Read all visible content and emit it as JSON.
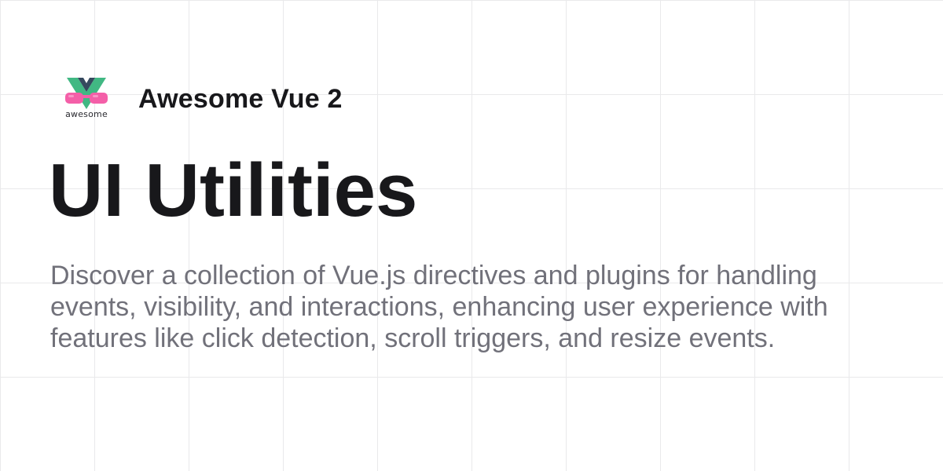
{
  "brand": {
    "logo_icon": "awesome-vue-logo-icon",
    "logo_text": "awesome",
    "name": "Awesome Vue 2"
  },
  "page": {
    "title": "UI Utilities",
    "description": "Discover a collection of Vue.js directives and plugins for handling events, visibility, and interactions, enhancing user experience with features like click detection, scroll triggers, and resize events."
  },
  "colors": {
    "vue_green": "#41b883",
    "vue_dark": "#35495e",
    "glasses_pink": "#f45fa8",
    "title": "#18181b",
    "description": "#71717a",
    "grid": "#e9e9eb"
  }
}
